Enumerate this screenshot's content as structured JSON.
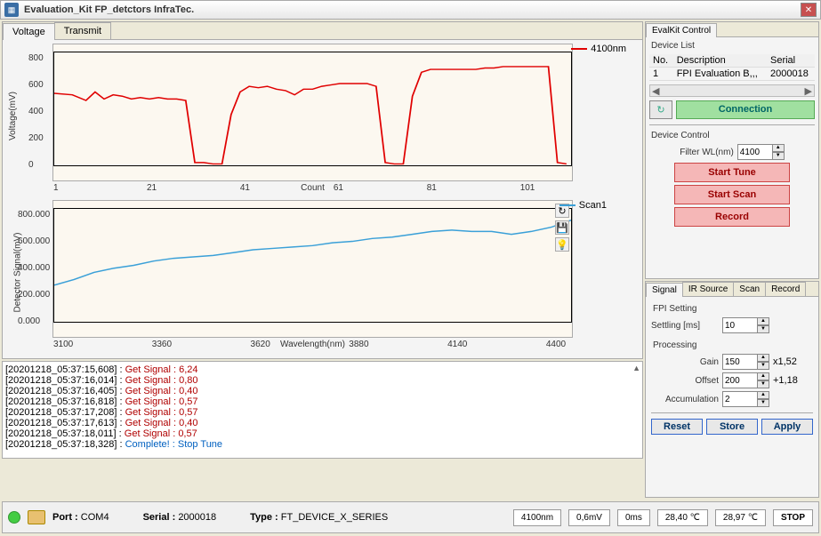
{
  "window": {
    "title": "Evaluation_Kit FP_detctors  InfraTec."
  },
  "tabs": {
    "voltage": "Voltage",
    "transmit": "Transmit"
  },
  "chart1": {
    "legend": "4100nm",
    "legend_color": "#e00000",
    "xlabel": "Count",
    "ylabel": "Voltage(mV)",
    "yticks": [
      "0",
      "200",
      "400",
      "600",
      "800"
    ],
    "xticks": [
      "1",
      "21",
      "41",
      "61",
      "81",
      "101"
    ]
  },
  "chart2": {
    "legend": "Scan1",
    "legend_color": "#3aa0d8",
    "xlabel": "Wavelength(nm)",
    "ylabel": "Detector Signal(mV)",
    "yticks": [
      "0.000",
      "200.000",
      "400.000",
      "600.000",
      "800.000"
    ],
    "xticks": [
      "3100",
      "3360",
      "3620",
      "3880",
      "4140",
      "4400"
    ],
    "icons": {
      "refresh": "↻",
      "save": "💾",
      "info": "💡"
    }
  },
  "log": [
    {
      "ts": "[20201218_05:37:15,608]",
      "msg": "Get Signal : 6,24",
      "cls": ""
    },
    {
      "ts": "[20201218_05:37:16,014]",
      "msg": "Get Signal : 0,80",
      "cls": ""
    },
    {
      "ts": "[20201218_05:37:16,405]",
      "msg": "Get Signal : 0,40",
      "cls": ""
    },
    {
      "ts": "[20201218_05:37:16,818]",
      "msg": "Get Signal : 0,57",
      "cls": ""
    },
    {
      "ts": "[20201218_05:37:17,208]",
      "msg": "Get Signal : 0,57",
      "cls": ""
    },
    {
      "ts": "[20201218_05:37:17,613]",
      "msg": "Get Signal : 0,40",
      "cls": ""
    },
    {
      "ts": "[20201218_05:37:18,011]",
      "msg": "Get Signal : 0,57",
      "cls": ""
    },
    {
      "ts": "[20201218_05:37:18,328]",
      "msg": "Complete! : Stop Tune",
      "cls": "complete"
    }
  ],
  "ctrl": {
    "header": "EvalKit Control",
    "device_list": "Device List",
    "cols": {
      "no": "No.",
      "desc": "Description",
      "serial": "Serial"
    },
    "row": {
      "no": "1",
      "desc": "FPI Evaluation B,,,",
      "serial": "2000018"
    },
    "refresh": "↻",
    "connection": "Connection",
    "device_control": "Device Control",
    "filter_label": "Filter WL(nm)",
    "filter_val": "4100",
    "start_tune": "Start Tune",
    "start_scan": "Start Scan",
    "record": "Record"
  },
  "sig": {
    "tabs": {
      "signal": "Signal",
      "ir": "IR Source",
      "scan": "Scan",
      "rec": "Record"
    },
    "fpi_setting": "FPI Setting",
    "settling_label": "Settling [ms]",
    "settling_val": "10",
    "processing": "Processing",
    "gain_label": "Gain",
    "gain_val": "150",
    "gain_mult": "x1,52",
    "offset_label": "Offset",
    "offset_val": "200",
    "offset_add": "+1,18",
    "accum_label": "Accumulation",
    "accum_val": "2",
    "reset": "Reset",
    "store": "Store",
    "apply": "Apply"
  },
  "status": {
    "port_label": "Port : ",
    "port": "COM4",
    "serial_label": "Serial : ",
    "serial": "2000018",
    "type_label": "Type : ",
    "type": "FT_DEVICE_X_SERIES",
    "wl": "4100nm",
    "volt": "0,6mV",
    "time": "0ms",
    "t1": "28,40 ℃",
    "t2": "28,97 ℃",
    "stop": "STOP"
  },
  "chart_data": [
    {
      "type": "line",
      "title": "",
      "xlabel": "Count",
      "ylabel": "Voltage(mV)",
      "xlim": [
        1,
        115
      ],
      "ylim": [
        0,
        800
      ],
      "series": [
        {
          "name": "4100nm",
          "color": "#e00000",
          "x": [
            1,
            5,
            8,
            10,
            12,
            14,
            16,
            18,
            20,
            22,
            24,
            26,
            28,
            30,
            32,
            34,
            36,
            38,
            40,
            42,
            44,
            46,
            48,
            50,
            52,
            54,
            56,
            58,
            60,
            62,
            64,
            66,
            68,
            70,
            72,
            74,
            76,
            78,
            80,
            82,
            84,
            86,
            88,
            90,
            92,
            94,
            96,
            98,
            100,
            102,
            104,
            106,
            108,
            110,
            112,
            114
          ],
          "y": [
            510,
            500,
            460,
            520,
            470,
            500,
            490,
            470,
            480,
            470,
            480,
            470,
            470,
            460,
            20,
            20,
            10,
            10,
            360,
            520,
            560,
            550,
            560,
            540,
            530,
            500,
            540,
            540,
            560,
            570,
            580,
            580,
            580,
            580,
            560,
            20,
            10,
            10,
            490,
            660,
            680,
            680,
            680,
            680,
            680,
            680,
            690,
            690,
            700,
            700,
            700,
            700,
            700,
            700,
            20,
            10
          ]
        }
      ]
    },
    {
      "type": "line",
      "title": "",
      "xlabel": "Wavelength(nm)",
      "ylabel": "Detector Signal(mV)",
      "xlim": [
        3100,
        4400
      ],
      "ylim": [
        0,
        800
      ],
      "series": [
        {
          "name": "Scan1",
          "color": "#3aa0d8",
          "x": [
            3100,
            3150,
            3200,
            3250,
            3300,
            3350,
            3400,
            3450,
            3500,
            3550,
            3600,
            3650,
            3700,
            3750,
            3800,
            3850,
            3900,
            3950,
            4000,
            4050,
            4100,
            4150,
            4200,
            4250,
            4300,
            4350,
            4400
          ],
          "y": [
            260,
            300,
            350,
            380,
            400,
            430,
            450,
            460,
            470,
            490,
            510,
            520,
            530,
            540,
            560,
            570,
            590,
            600,
            620,
            640,
            650,
            640,
            640,
            620,
            640,
            670,
            720
          ]
        }
      ]
    }
  ]
}
